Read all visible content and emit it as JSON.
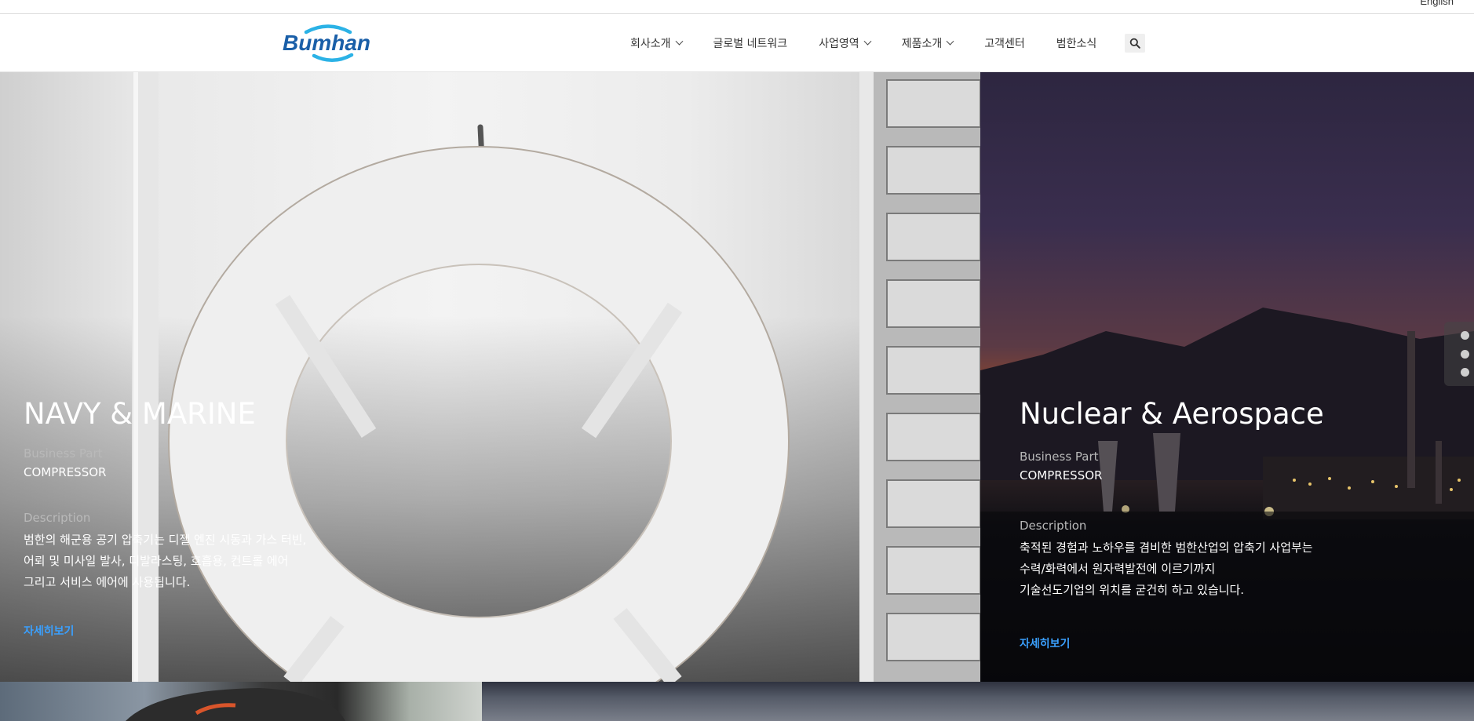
{
  "topbar": {
    "language_label": "English"
  },
  "header": {
    "logo_text": "Bumhan",
    "nav": [
      {
        "label": "회사소개",
        "has_dropdown": true
      },
      {
        "label": "글로벌 네트워크",
        "has_dropdown": false
      },
      {
        "label": "사업영역",
        "has_dropdown": true
      },
      {
        "label": "제품소개",
        "has_dropdown": true
      },
      {
        "label": "고객센터",
        "has_dropdown": false
      },
      {
        "label": "범한소식",
        "has_dropdown": false
      }
    ],
    "search_icon": "search-icon"
  },
  "panels": [
    {
      "title": "NAVY & MARINE",
      "business_label": "Business Part",
      "business_value": "COMPRESSOR",
      "description_label": "Description",
      "description_lines": [
        "범한의 해군용 공기 압축기는 디젤 엔진 시동과 가스 터빈,",
        "어뢰 및 미사일 발사, 디발라스팅, 호흡용, 컨트롤 에어",
        "그리고 서비스 에어에 사용됩니다."
      ],
      "more_label": "자세히보기"
    },
    {
      "title": "Nuclear & Aerospace",
      "business_label": "Business Part",
      "business_value": "COMPRESSOR",
      "description_label": "Description",
      "description_lines": [
        "축적된 경험과 노하우를 겸비한 범한산업의 압축기 사업부는",
        "수력/화력에서 원자력발전에 이르기까지",
        "기술선도기업의 위치를 굳건히 하고 있습니다."
      ],
      "more_label": "자세히보기"
    }
  ],
  "pager": {
    "dots": 3
  },
  "colors": {
    "brand_blue": "#1a5fa8",
    "brand_cyan": "#2bb2e6",
    "link_blue": "#3aa0ff"
  }
}
